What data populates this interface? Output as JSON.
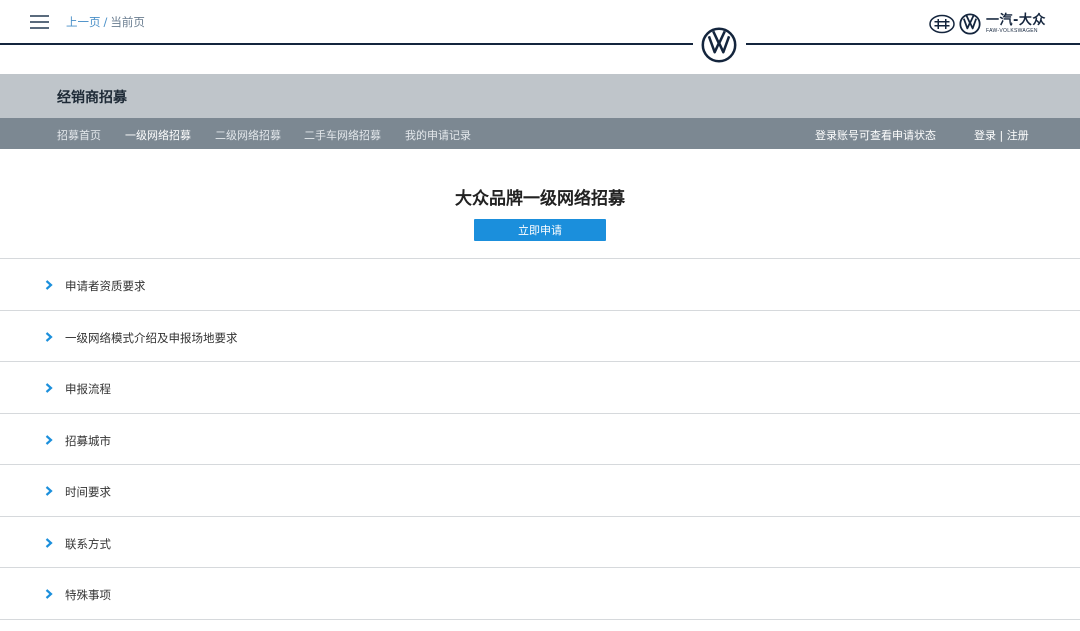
{
  "header": {
    "breadcrumb_prev": "上一页",
    "breadcrumb_sep": "/",
    "breadcrumb_current": "当前页",
    "brand_cn": "一汽-大众",
    "brand_en": "FAW-VOLKSWAGEN",
    "menu_icon": "hamburger-menu-icon",
    "logo_icon": "volkswagen-logo-icon"
  },
  "section": {
    "title": "经销商招募"
  },
  "nav": {
    "items": [
      {
        "label": "招募首页"
      },
      {
        "label": "一级网络招募"
      },
      {
        "label": "二级网络招募"
      },
      {
        "label": "二手车网络招募"
      },
      {
        "label": "我的申请记录"
      }
    ],
    "active_index": 1,
    "login_hint": "登录账号可查看申请状态",
    "login": "登录",
    "divider": "|",
    "register": "注册"
  },
  "main": {
    "title": "大众品牌一级网络招募",
    "apply_button": "立即申请"
  },
  "accordion": {
    "items": [
      {
        "label": "申请者资质要求"
      },
      {
        "label": "一级网络模式介绍及申报场地要求"
      },
      {
        "label": "申报流程"
      },
      {
        "label": "招募城市"
      },
      {
        "label": "时间要求"
      },
      {
        "label": "联系方式"
      },
      {
        "label": "特殊事项"
      }
    ]
  },
  "colors": {
    "navy": "#14253d",
    "accent_blue": "#1b8fdc",
    "section_bar": "#bfc5ca",
    "nav_bar": "#7c8892",
    "breadcrumb_link": "#4a90c8"
  }
}
